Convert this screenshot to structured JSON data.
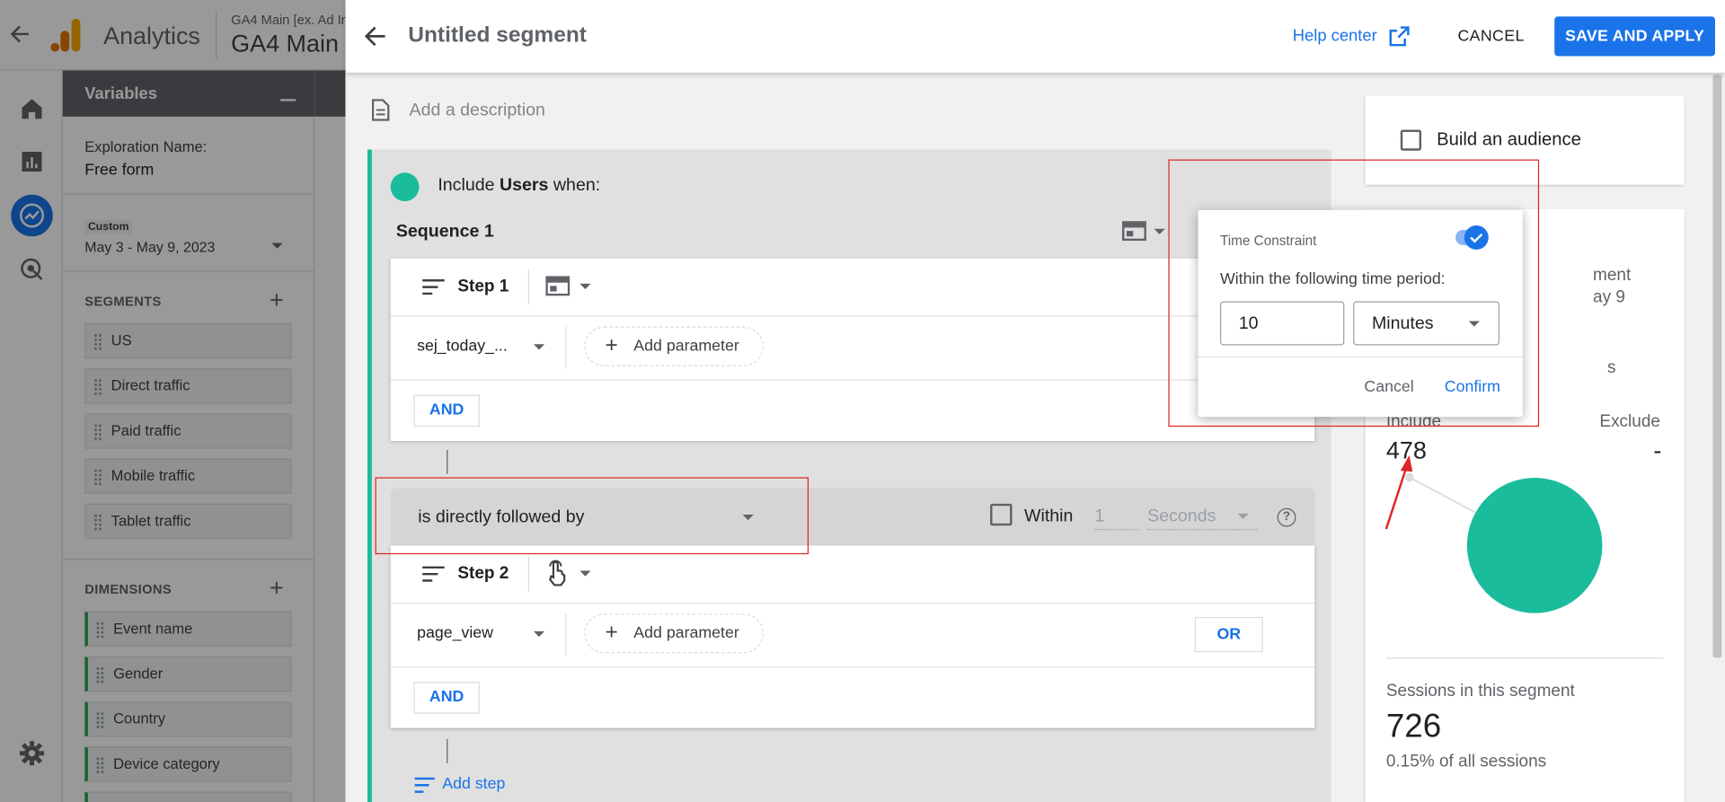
{
  "ga": {
    "brand": "Analytics",
    "account_line": "GA4 Main [ex. Ad In",
    "property_title": "GA4 Main",
    "variables_title": "Variables",
    "exploration_name_label": "Exploration Name:",
    "exploration_name_value": "Free form",
    "date_range_tag": "Custom",
    "date_range_value": "May 3 - May 9, 2023",
    "segments_heading": "SEGMENTS",
    "segments": [
      "US",
      "Direct traffic",
      "Paid traffic",
      "Mobile traffic",
      "Tablet traffic"
    ],
    "dimensions_heading": "DIMENSIONS",
    "dimensions": [
      "Event name",
      "Gender",
      "Country",
      "Device category"
    ]
  },
  "dialog": {
    "title": "Untitled segment",
    "help_center": "Help center",
    "cancel": "CANCEL",
    "save_apply": "SAVE AND APPLY",
    "description_placeholder": "Add a description"
  },
  "condition": {
    "include_prefix": "Include",
    "include_scope": "Users",
    "include_suffix": "when:",
    "sequence_title": "Sequence 1",
    "step1": {
      "title": "Step 1",
      "event": "sej_today_...",
      "add_parameter": "Add parameter",
      "and": "AND"
    },
    "connector": {
      "value": "is directly followed by",
      "within_label": "Within",
      "within_value": "1",
      "within_unit": "Seconds"
    },
    "step2": {
      "title": "Step 2",
      "event": "page_view",
      "add_parameter": "Add parameter",
      "or": "OR",
      "and": "AND"
    },
    "add_step": "Add step"
  },
  "side": {
    "build_audience": "Build an audience",
    "summary_partial_1": "ment",
    "summary_partial_2": "ay 9",
    "summary_partial_3": "s",
    "include_label": "Include",
    "exclude_label": "Exclude",
    "include_value": "478",
    "exclude_value": "-",
    "sessions_label": "Sessions in this segment",
    "sessions_value": "726",
    "sessions_pct": "0.15% of all sessions"
  },
  "popover": {
    "title": "Time Constraint",
    "toggle_on": true,
    "period_label": "Within the following time period:",
    "amount": "10",
    "unit": "Minutes",
    "cancel": "Cancel",
    "confirm": "Confirm"
  },
  "colors": {
    "accent_blue": "#1a73e8",
    "segment_teal": "#1abc9c",
    "annotation_red": "#e02424"
  }
}
